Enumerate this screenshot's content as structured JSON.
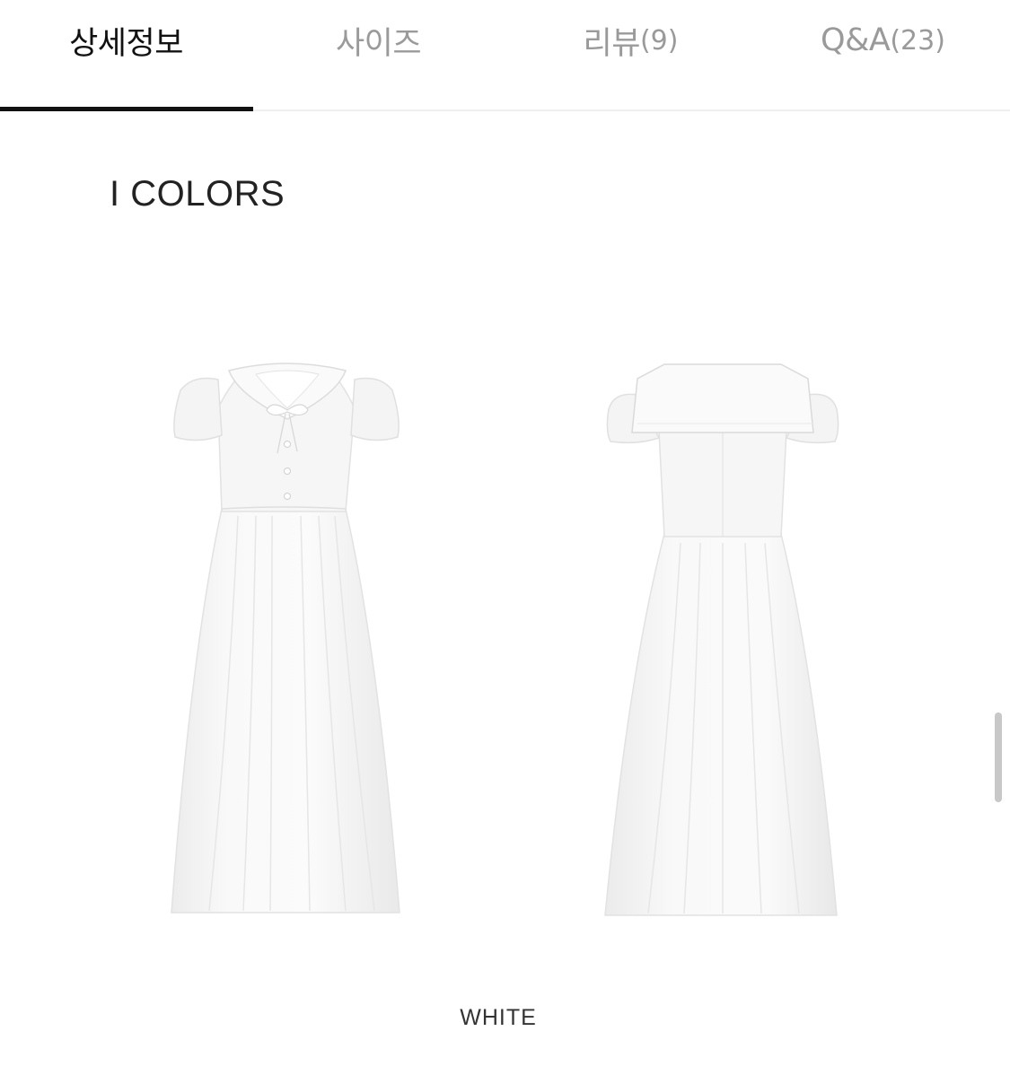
{
  "tabs": [
    {
      "label": "상세정보",
      "count": "",
      "active": true
    },
    {
      "label": "사이즈",
      "count": "",
      "active": false
    },
    {
      "label": "리뷰",
      "count": "(9)",
      "active": false
    },
    {
      "label": "Q&A",
      "count": "(23)",
      "active": false
    }
  ],
  "section": {
    "title": "I COLORS"
  },
  "product_images": [
    {
      "view": "front",
      "color_name": "WHITE"
    },
    {
      "view": "back",
      "color_name": "WHITE"
    }
  ],
  "caption": "WHITE",
  "colors": {
    "active_tab_text": "#111111",
    "inactive_tab_text": "#9a9a9a",
    "indicator": "#111111",
    "dress_fabric": "#f7f7f7"
  }
}
